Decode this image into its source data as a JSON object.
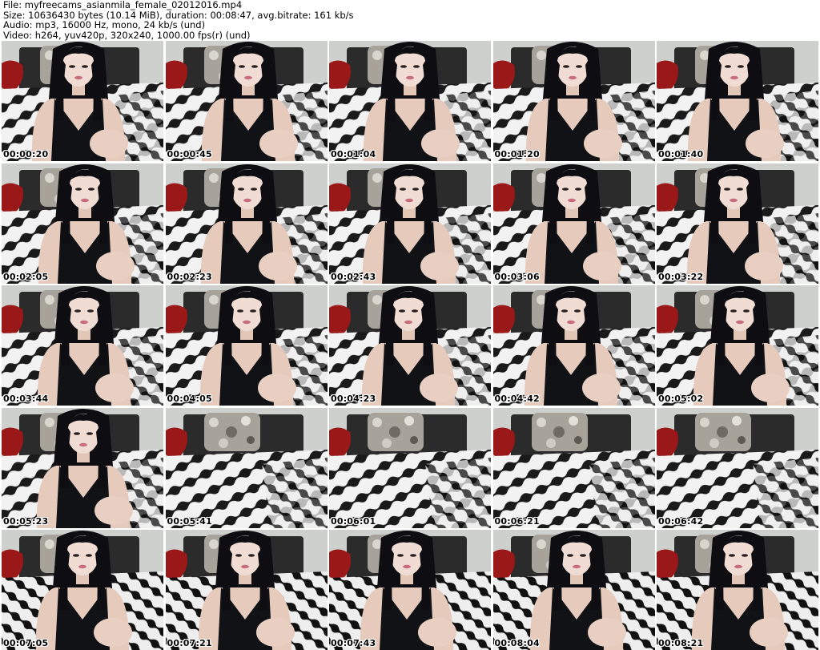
{
  "header": {
    "file_line": "File: myfreecams_asianmila_female_02012016.mp4",
    "size_line": "Size: 10636430 bytes (10.14 MiB), duration: 00:08:47, avg.bitrate: 161 kb/s",
    "audio_line": "Audio: mp3, 16000 Hz, mono, 24 kb/s (und)",
    "video_line": "Video: h264, yuv420p, 320x240, 1000.00 fps(r) (und)"
  },
  "frames": [
    {
      "timestamp": "00:00:20",
      "scene": "person"
    },
    {
      "timestamp": "00:00:45",
      "scene": "person"
    },
    {
      "timestamp": "00:01:04",
      "scene": "person"
    },
    {
      "timestamp": "00:01:20",
      "scene": "person"
    },
    {
      "timestamp": "00:01:40",
      "scene": "person"
    },
    {
      "timestamp": "00:02:05",
      "scene": "person"
    },
    {
      "timestamp": "00:02:23",
      "scene": "person"
    },
    {
      "timestamp": "00:02:43",
      "scene": "person"
    },
    {
      "timestamp": "00:03:06",
      "scene": "person"
    },
    {
      "timestamp": "00:03:22",
      "scene": "person"
    },
    {
      "timestamp": "00:03:44",
      "scene": "person"
    },
    {
      "timestamp": "00:04:05",
      "scene": "person"
    },
    {
      "timestamp": "00:04:23",
      "scene": "person"
    },
    {
      "timestamp": "00:04:42",
      "scene": "person"
    },
    {
      "timestamp": "00:05:02",
      "scene": "person"
    },
    {
      "timestamp": "00:05:23",
      "scene": "person"
    },
    {
      "timestamp": "00:05:41",
      "scene": "empty-bed"
    },
    {
      "timestamp": "00:06:01",
      "scene": "empty-bed"
    },
    {
      "timestamp": "00:06:21",
      "scene": "empty-bed"
    },
    {
      "timestamp": "00:06:42",
      "scene": "empty-bed"
    },
    {
      "timestamp": "00:07:05",
      "scene": "person"
    },
    {
      "timestamp": "00:07:21",
      "scene": "person"
    },
    {
      "timestamp": "00:07:43",
      "scene": "person"
    },
    {
      "timestamp": "00:08:04",
      "scene": "person"
    },
    {
      "timestamp": "00:08:21",
      "scene": "person"
    }
  ]
}
